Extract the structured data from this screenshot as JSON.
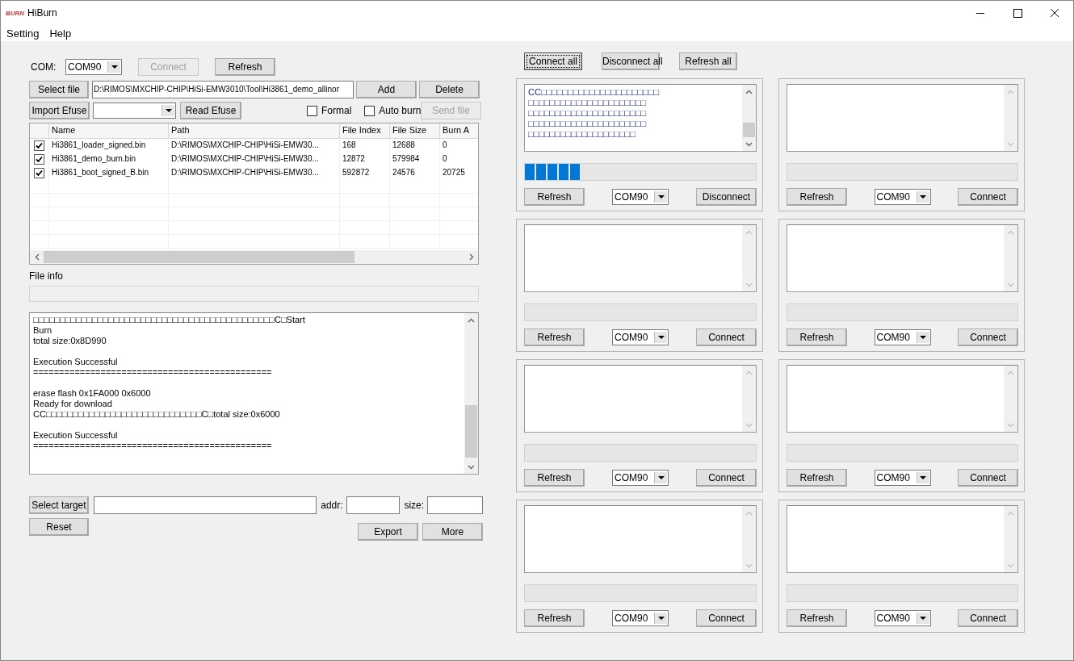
{
  "window": {
    "icon_text": "BURN",
    "title": "HiBurn"
  },
  "menu": [
    "Setting",
    "Help"
  ],
  "com_row": {
    "label": "COM:",
    "port": "COM90",
    "buttons": [
      {
        "label": "Connect",
        "disabled": true
      },
      {
        "label": "Refresh",
        "disabled": false
      }
    ]
  },
  "file_row": {
    "button": "Select file",
    "path": "D:\\RIMOS\\MXCHIP-CHIP\\HiSi-EMW3010\\Tool\\Hi3861_demo_allinor",
    "buttons": [
      {
        "label": "Add",
        "disabled": false
      },
      {
        "label": "Delete",
        "disabled": false
      }
    ]
  },
  "efuse_row": {
    "button": "Import Efuse",
    "read_button": "Read Efuse",
    "checkboxes": [
      {
        "label": "Formal",
        "checked": false
      },
      {
        "label": "Auto burn",
        "checked": false
      }
    ],
    "send_button": {
      "label": "Send file",
      "disabled": true
    }
  },
  "file_table": {
    "columns": [
      "Name",
      "Path",
      "File Index",
      "File Size",
      "Burn A"
    ],
    "rows": [
      {
        "checked": true,
        "cells": [
          "Hi3861_loader_signed.bin",
          "D:\\RIMOS\\MXCHIP-CHIP\\HiSi-EMW30...",
          "168",
          "12688",
          "0"
        ]
      },
      {
        "checked": true,
        "cells": [
          "Hi3861_demo_burn.bin",
          "D:\\RIMOS\\MXCHIP-CHIP\\HiSi-EMW30...",
          "12872",
          "579984",
          "0"
        ]
      },
      {
        "checked": true,
        "cells": [
          "Hi3861_boot_signed_B.bin",
          "D:\\RIMOS\\MXCHIP-CHIP\\HiSi-EMW30...",
          "592872",
          "24576",
          "20725"
        ]
      }
    ]
  },
  "file_info": {
    "label": "File info"
  },
  "log": [
    [
      "□□□□□□□□□□□□□□□□□□□□□□□□□□□□□□□□□□□□□□□□□□□□□C□Start",
      "Burn",
      "total size:0x8D990"
    ],
    [
      "Execution Successful",
      "=============================================="
    ],
    [
      "erase flash 0x1FA000 0x6000",
      "Ready for download",
      "CC□□□□□□□□□□□□□□□□□□□□□□□□□□□□□C□total size:0x6000"
    ],
    [
      "Execution Successful",
      "=============================================="
    ]
  ],
  "target_row": {
    "button": "Select target",
    "addr_label": "addr:",
    "size_label": "size:"
  },
  "bottom_buttons": [
    {
      "label": "Reset",
      "kind": "left"
    },
    {
      "label": "Export",
      "kind": "right"
    },
    {
      "label": "More",
      "kind": "right"
    }
  ],
  "top_buttons": [
    {
      "label": "Connect all",
      "focused": true
    },
    {
      "label": "Disconnect all",
      "focused": false
    },
    {
      "label": "Refresh all",
      "focused": false
    }
  ],
  "panels": [
    {
      "log": [
        "CC□□□□□□□□□□□□□□□□□□□□□□",
        "□□□□□□□□□□□□□□□□□□□□□□",
        "□□□□□□□□□□□□□□□□□□□□□□",
        "□□□□□□□□□□□□□□□□□□□□□□",
        "□□□□□□□□□□□□□□□□□□□□"
      ],
      "level": 0.24,
      "refresh": "Refresh",
      "port": "COM90",
      "action": "Disconnect"
    },
    {
      "refresh": "Refresh",
      "port": "COM90",
      "action": "Connect"
    },
    {
      "refresh": "Refresh",
      "port": "COM90",
      "action": "Connect"
    },
    {
      "refresh": "Refresh",
      "port": "COM90",
      "action": "Connect"
    },
    {
      "refresh": "Refresh",
      "port": "COM90",
      "action": "Connect"
    },
    {
      "refresh": "Refresh",
      "port": "COM90",
      "action": "Connect"
    },
    {
      "refresh": "Refresh",
      "port": "COM90",
      "action": "Connect"
    },
    {
      "refresh": "Refresh",
      "port": "COM90",
      "action": "Connect"
    }
  ]
}
